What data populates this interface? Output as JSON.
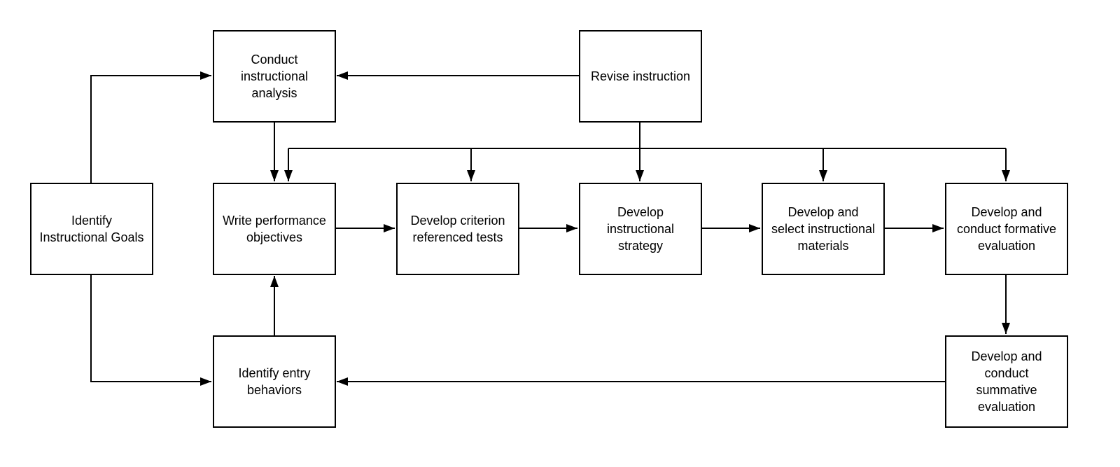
{
  "nodes": {
    "goals": {
      "lines": [
        "Identify",
        "Instructional Goals"
      ]
    },
    "analysis": {
      "lines": [
        "Conduct",
        "instructional",
        "analysis"
      ]
    },
    "revise": {
      "lines": [
        "Revise instruction"
      ]
    },
    "objectives": {
      "lines": [
        "Write performance",
        "objectives"
      ]
    },
    "tests": {
      "lines": [
        "Develop criterion",
        "referenced tests"
      ]
    },
    "strategy": {
      "lines": [
        "Develop",
        "instructional",
        "strategy"
      ]
    },
    "materials": {
      "lines": [
        "Develop and",
        "select instructional",
        "materials"
      ]
    },
    "formative": {
      "lines": [
        "Develop and",
        "conduct formative",
        "evaluation"
      ]
    },
    "entry": {
      "lines": [
        "Identify entry",
        "behaviors"
      ]
    },
    "summative": {
      "lines": [
        "Develop and",
        "conduct",
        "summative",
        "evaluation"
      ]
    }
  },
  "edges": [
    [
      "goals",
      "analysis"
    ],
    [
      "goals",
      "entry"
    ],
    [
      "revise",
      "analysis"
    ],
    [
      "revise",
      "objectives"
    ],
    [
      "revise",
      "tests"
    ],
    [
      "revise",
      "strategy"
    ],
    [
      "revise",
      "materials"
    ],
    [
      "revise",
      "formative"
    ],
    [
      "analysis",
      "objectives"
    ],
    [
      "entry",
      "objectives"
    ],
    [
      "objectives",
      "tests"
    ],
    [
      "tests",
      "strategy"
    ],
    [
      "strategy",
      "materials"
    ],
    [
      "materials",
      "formative"
    ],
    [
      "formative",
      "summative"
    ],
    [
      "summative",
      "entry"
    ]
  ],
  "colors": {
    "stroke": "#000000",
    "fill": "#ffffff"
  }
}
